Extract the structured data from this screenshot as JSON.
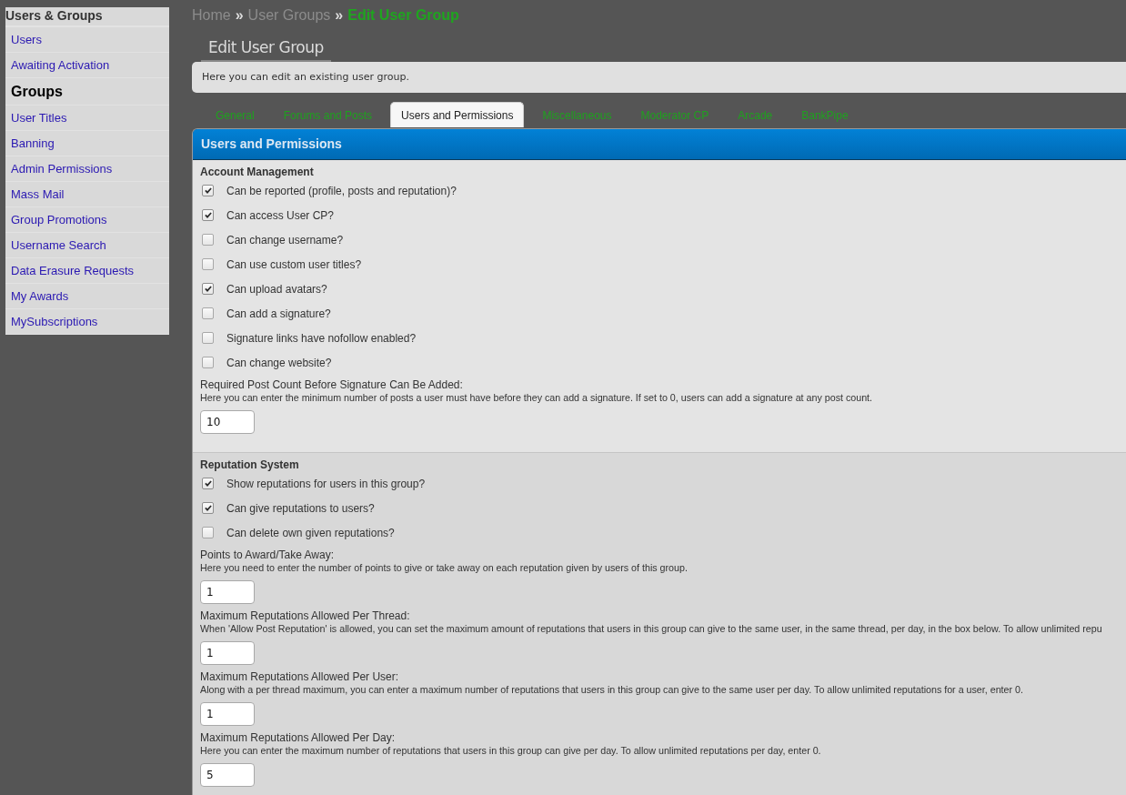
{
  "sidebar": {
    "title": "Users & Groups",
    "items": [
      {
        "label": "Users",
        "selected": false
      },
      {
        "label": "Awaiting Activation",
        "selected": false
      },
      {
        "label": "Groups",
        "selected": true
      },
      {
        "label": "User Titles",
        "selected": false
      },
      {
        "label": "Banning",
        "selected": false
      },
      {
        "label": "Admin Permissions",
        "selected": false
      },
      {
        "label": "Mass Mail",
        "selected": false
      },
      {
        "label": "Group Promotions",
        "selected": false
      },
      {
        "label": "Username Search",
        "selected": false
      },
      {
        "label": "Data Erasure Requests",
        "selected": false
      },
      {
        "label": "My Awards",
        "selected": false
      },
      {
        "label": "MySubscriptions",
        "selected": false
      }
    ]
  },
  "breadcrumb": {
    "items": [
      {
        "label": "Home",
        "current": false
      },
      {
        "label": "User Groups",
        "current": false
      },
      {
        "label": "Edit User Group",
        "current": true
      }
    ],
    "separators": [
      "»",
      "»"
    ]
  },
  "page_title": "Edit User Group",
  "description": "Here you can edit an existing user group.",
  "tabs": [
    {
      "label": "General",
      "selected": false
    },
    {
      "label": "Forums and Posts",
      "selected": false
    },
    {
      "label": "Users and Permissions",
      "selected": true
    },
    {
      "label": "Miscellaneous",
      "selected": false
    },
    {
      "label": "Moderator CP",
      "selected": false
    },
    {
      "label": "Arcade",
      "selected": false
    },
    {
      "label": "BankPipe",
      "selected": false
    }
  ],
  "panel": {
    "title": "Users and Permissions",
    "sections": [
      {
        "title": "Account Management",
        "rows": [
          {
            "kind": "checkbox",
            "label": "Can be reported (profile, posts and reputation)?",
            "checked": true
          },
          {
            "kind": "checkbox",
            "label": "Can access User CP?",
            "checked": true
          },
          {
            "kind": "checkbox",
            "label": "Can change username?",
            "checked": false
          },
          {
            "kind": "checkbox",
            "label": "Can use custom user titles?",
            "checked": false
          },
          {
            "kind": "checkbox",
            "label": "Can upload avatars?",
            "checked": true
          },
          {
            "kind": "checkbox",
            "label": "Can add a signature?",
            "checked": false
          },
          {
            "kind": "checkbox",
            "label": "Signature links have nofollow enabled?",
            "checked": false
          },
          {
            "kind": "checkbox",
            "label": "Can change website?",
            "checked": false
          },
          {
            "kind": "number",
            "label": "Required Post Count Before Signature Can Be Added:",
            "help": "Here you can enter the minimum number of posts a user must have before they can add a signature. If set to 0, users can add a signature at any post count.",
            "value": "10"
          }
        ]
      },
      {
        "title": "Reputation System",
        "rows": [
          {
            "kind": "checkbox",
            "label": "Show reputations for users in this group?",
            "checked": true
          },
          {
            "kind": "checkbox",
            "label": "Can give reputations to users?",
            "checked": true
          },
          {
            "kind": "checkbox",
            "label": "Can delete own given reputations?",
            "checked": false
          },
          {
            "kind": "number",
            "label": "Points to Award/Take Away:",
            "help": "Here you need to enter the number of points to give or take away on each reputation given by users of this group.",
            "value": "1"
          },
          {
            "kind": "number",
            "label": "Maximum Reputations Allowed Per Thread:",
            "help": "When 'Allow Post Reputation' is allowed, you can set the maximum amount of reputations that users in this group can give to the same user, in the same thread, per day, in the box below. To allow unlimited repu",
            "value": "1"
          },
          {
            "kind": "number",
            "label": "Maximum Reputations Allowed Per User:",
            "help": "Along with a per thread maximum, you can enter a maximum number of reputations that users in this group can give to the same user per day. To allow unlimited reputations for a user, enter 0.",
            "value": "1"
          },
          {
            "kind": "number",
            "label": "Maximum Reputations Allowed Per Day:",
            "help": "Here you can enter the maximum number of reputations that users in this group can give per day. To allow unlimited reputations per day, enter 0.",
            "value": "5"
          }
        ]
      }
    ]
  }
}
